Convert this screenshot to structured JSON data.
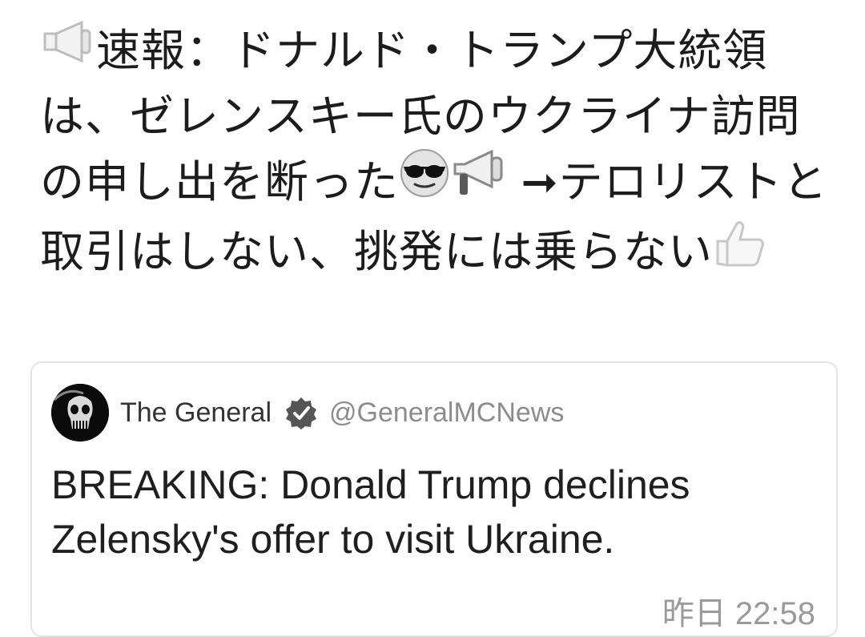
{
  "post": {
    "segment1": "速報：ドナルド・トランプ大統領は、ゼレンスキー氏のウクライナ訪問の申し出を断った",
    "arrow": "➞",
    "segment2": "テロリストと取引はしない、挑発には乗らない",
    "emojis": {
      "start": "megaphone-icon",
      "mid1": "sunglasses-face-icon",
      "mid2": "megaphone-icon",
      "end": "thumbs-up-icon"
    }
  },
  "quote": {
    "display_name": "The General",
    "handle": "@GeneralMCNews",
    "text": "BREAKING: Donald Trump declines Zelensky's offer to visit Ukraine.",
    "timestamp": "昨日 22:58",
    "verified": true
  },
  "colors": {
    "text": "#1c1c1c",
    "muted": "#8c8c8c",
    "border": "#e4e4e4",
    "badge": "#555555"
  }
}
